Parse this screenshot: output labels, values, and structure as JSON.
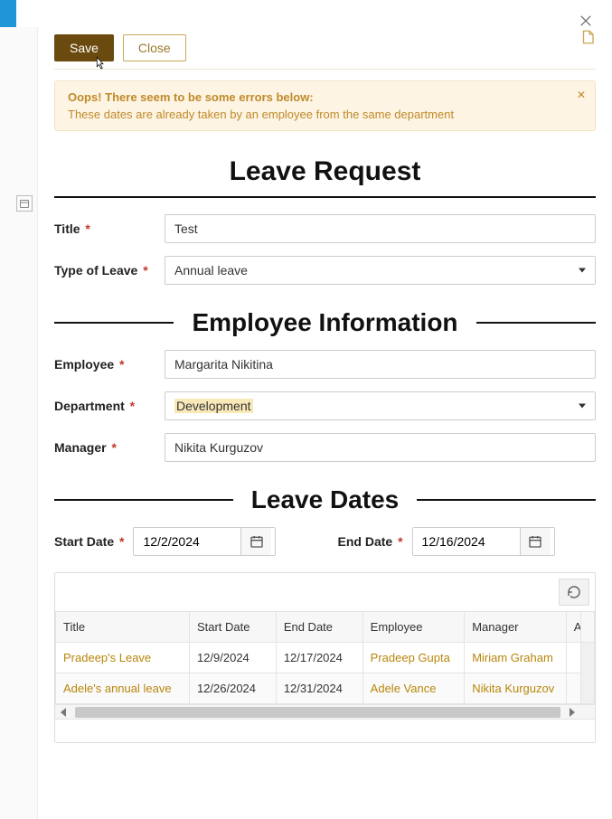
{
  "buttons": {
    "save": "Save",
    "close": "Close"
  },
  "alert": {
    "title": "Oops! There seem to be some errors below:",
    "message": "These dates are already taken by an employee from the same department"
  },
  "page_title": "Leave Request",
  "fields": {
    "title": {
      "label": "Title",
      "value": "Test"
    },
    "type_of_leave": {
      "label": "Type of Leave",
      "value": "Annual leave"
    }
  },
  "sections": {
    "employee_info": "Employee Information",
    "leave_dates": "Leave Dates"
  },
  "employee": {
    "employee": {
      "label": "Employee",
      "value": "Margarita Nikitina"
    },
    "department": {
      "label": "Department",
      "value": "Development"
    },
    "manager": {
      "label": "Manager",
      "value": "Nikita Kurguzov"
    }
  },
  "dates": {
    "start": {
      "label": "Start Date",
      "value": "12/2/2024"
    },
    "end": {
      "label": "End Date",
      "value": "12/16/2024"
    }
  },
  "grid": {
    "columns": [
      "Title",
      "Start Date",
      "End Date",
      "Employee",
      "Manager",
      "A"
    ],
    "rows": [
      {
        "title": "Pradeep's Leave",
        "start": "12/9/2024",
        "end": "12/17/2024",
        "employee": "Pradeep Gupta",
        "manager": "Miriam Graham"
      },
      {
        "title": "Adele's annual leave",
        "start": "12/26/2024",
        "end": "12/31/2024",
        "employee": "Adele Vance",
        "manager": "Nikita Kurguzov"
      }
    ]
  }
}
